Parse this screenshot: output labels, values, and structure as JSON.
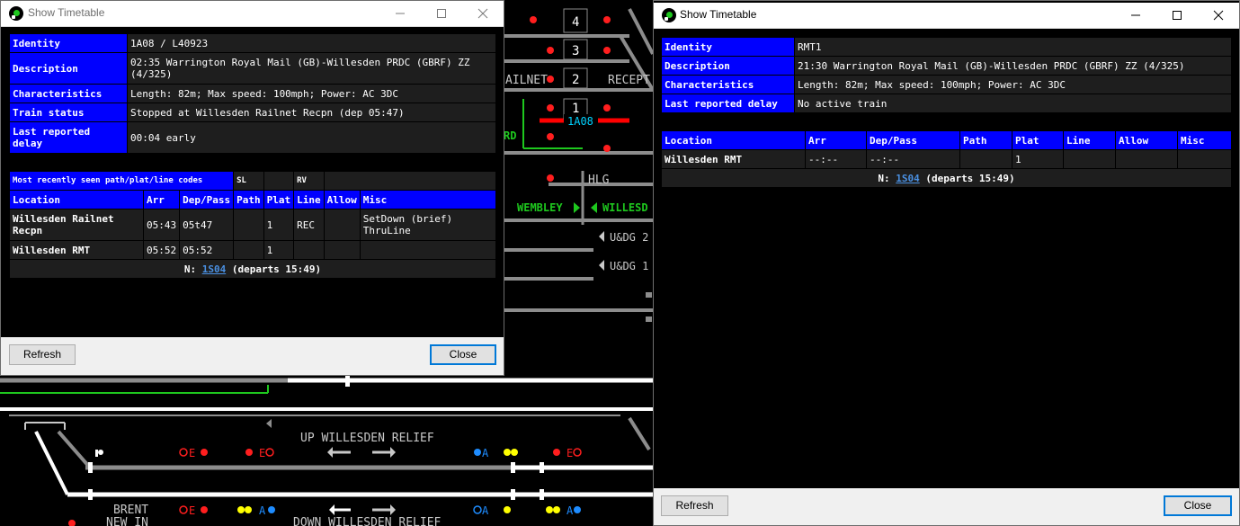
{
  "background": {
    "platforms": [
      "4",
      "3",
      "2",
      "1"
    ],
    "headcode_label": "1A08",
    "labels": {
      "railnet": "AILNET",
      "recept": "RECEPT",
      "rd": "RD",
      "hlg": "HLG",
      "wembley": "WEMBLEY",
      "willesden": "WILLESD",
      "udg2": "U&DG 2",
      "udg1": "U&DG 1",
      "up_willesden_relief": "UP WILLESDEN RELIEF",
      "down_willesden_relief": "DOWN WILLESDEN RELIEF",
      "brent": "BRENT",
      "new_in": "NEW IN",
      "sig_e": "E",
      "sig_a": "A"
    }
  },
  "window1": {
    "title": "Show Timetable",
    "info": [
      {
        "label": "Identity",
        "value": "1A08 / L40923"
      },
      {
        "label": "Description",
        "value": "02:35 Warrington Royal Mail (GB)-Willesden PRDC (GBRF) ZZ (4/325)"
      },
      {
        "label": "Characteristics",
        "value": "Length: 82m; Max speed: 100mph; Power: AC 3DC"
      },
      {
        "label": "Train status",
        "value": "Stopped at Willesden Railnet Recpn (dep 05:47)"
      },
      {
        "label": "Last reported delay",
        "value": "00:04 early"
      }
    ],
    "codes": {
      "label": "Most recently seen path/plat/line codes",
      "c1": "SL",
      "c2": "",
      "c3": "RV",
      "c4": ""
    },
    "columns": [
      "Location",
      "Arr",
      "Dep/Pass",
      "Path",
      "Plat",
      "Line",
      "Allow",
      "Misc"
    ],
    "rows": [
      {
        "location": "Willesden Railnet Recpn",
        "arr": "05:43",
        "dep": "05t47",
        "path": "",
        "plat": "1",
        "line": "REC",
        "allow": "",
        "misc": "SetDown (brief) ThruLine"
      },
      {
        "location": "Willesden RMT",
        "arr": "05:52",
        "dep": "05:52",
        "path": "",
        "plat": "1",
        "line": "",
        "allow": "",
        "misc": ""
      }
    ],
    "next": {
      "prefix": "N:",
      "link": "1S04",
      "suffix": "(departs 15:49)"
    },
    "refresh_label": "Refresh",
    "close_label": "Close"
  },
  "window2": {
    "title": "Show Timetable",
    "info": [
      {
        "label": "Identity",
        "value": "RMT1"
      },
      {
        "label": "Description",
        "value": "21:30 Warrington Royal Mail (GB)-Willesden PRDC (GBRF) ZZ (4/325)"
      },
      {
        "label": "Characteristics",
        "value": "Length: 82m; Max speed: 100mph; Power: AC 3DC"
      },
      {
        "label": "Last reported delay",
        "value": "No active train"
      }
    ],
    "columns": [
      "Location",
      "Arr",
      "Dep/Pass",
      "Path",
      "Plat",
      "Line",
      "Allow",
      "Misc"
    ],
    "rows": [
      {
        "location": "Willesden RMT",
        "arr": "--:--",
        "dep": "--:--",
        "path": "",
        "plat": "1",
        "line": "",
        "allow": "",
        "misc": ""
      }
    ],
    "next": {
      "prefix": "N:",
      "link": "1S04",
      "suffix": "(departs 15:49)"
    },
    "refresh_label": "Refresh",
    "close_label": "Close"
  },
  "colors": {
    "header_blue": "#0000ff",
    "cell_dark": "#1e1e1e",
    "track_grey": "#8c8c8c",
    "track_white": "#ffffff",
    "track_green": "#1ec81e",
    "track_red": "#ff0000",
    "headcode_cyan": "#00d2ff",
    "signal_red": "#ff1e1e",
    "signal_yellow": "#ffff00",
    "signal_blue": "#1e8cff"
  }
}
